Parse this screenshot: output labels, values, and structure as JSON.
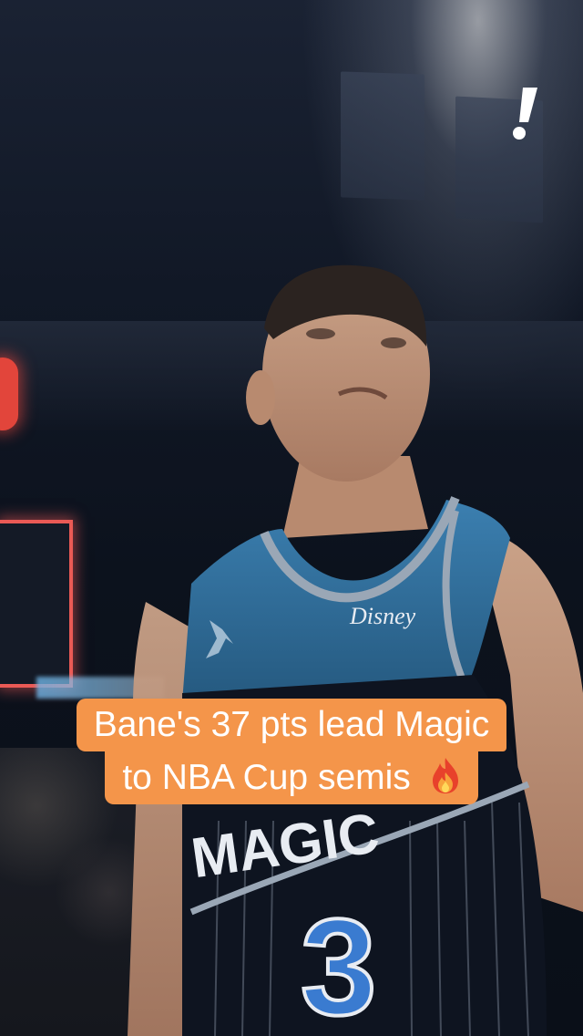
{
  "caption": {
    "line1": "Bane's 37 pts lead Magic",
    "line2": "to NBA Cup semis",
    "emoji": "fire-icon",
    "background_color": "#f4954a",
    "text_color": "#ffffff"
  },
  "jersey": {
    "sponsor": "Disney",
    "team_text": "MAGIC",
    "number": "3",
    "colors": {
      "top": "#2f6f9f",
      "body": "#0e1420",
      "trim": "#9aa7b6"
    }
  },
  "brand": {
    "logo_icon": "exclamation-icon"
  }
}
